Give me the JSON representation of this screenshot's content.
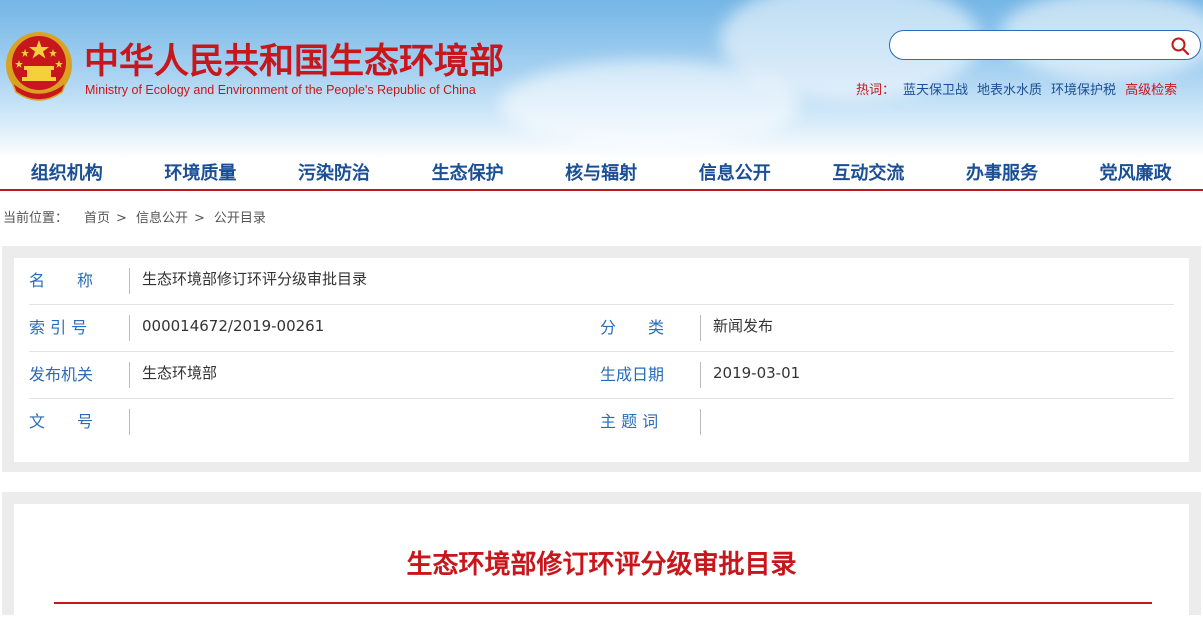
{
  "header": {
    "title": "中华人民共和国生态环境部",
    "subtitle": "Ministry of Ecology and Environment of the People's Republic of China",
    "search": {
      "placeholder": ""
    },
    "hotwords": {
      "label": "热词：",
      "items": [
        "蓝天保卫战",
        "地表水水质",
        "环境保护税"
      ],
      "advanced": "高级检索"
    }
  },
  "nav": {
    "items": [
      "组织机构",
      "环境质量",
      "污染防治",
      "生态保护",
      "核与辐射",
      "信息公开",
      "互动交流",
      "办事服务",
      "党风廉政"
    ]
  },
  "breadcrumb": {
    "label": "当前位置：",
    "items": [
      "首页",
      "信息公开",
      "公开目录"
    ],
    "sep": ">"
  },
  "info": {
    "name_label": "名　　称",
    "name_value": "生态环境部修订环评分级审批目录",
    "index_label": "索 引 号",
    "index_value": "000014672/2019-00261",
    "category_label": "分　　类",
    "category_value": "新闻发布",
    "publisher_label": "发布机关",
    "publisher_value": "生态环境部",
    "date_label": "生成日期",
    "date_value": "2019-03-01",
    "docno_label": "文　　号",
    "docno_value": "",
    "topic_label": "主 题 词",
    "topic_value": ""
  },
  "article": {
    "title": "生态环境部修订环评分级审批目录"
  },
  "colors": {
    "brand_red": "#c8161d",
    "link_blue": "#1a4f95",
    "label_blue": "#2a6cb8"
  }
}
